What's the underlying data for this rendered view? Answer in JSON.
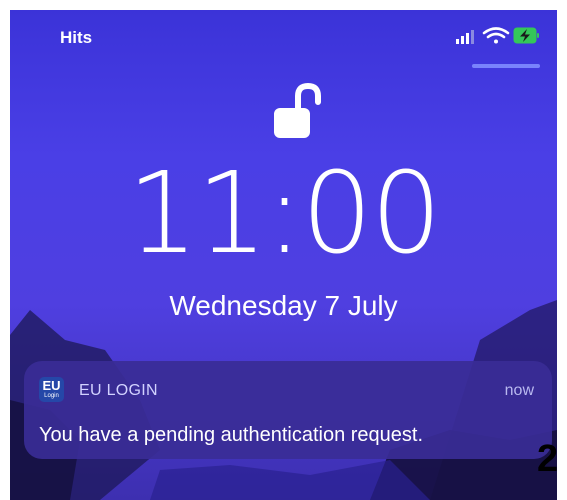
{
  "status_bar": {
    "carrier": "Hits",
    "icons": [
      "signal-icon",
      "wifi-icon",
      "battery-charging-icon"
    ]
  },
  "lock_screen": {
    "lock_icon": "unlocked-padlock-icon",
    "time": "11:00",
    "date": "Wednesday 7 July"
  },
  "notification": {
    "app_icon_text": "EU",
    "app_icon_subtext": "Login",
    "app_name": "EU LOGIN",
    "time": "now",
    "message": "You have a pending authentication request."
  },
  "annotation": {
    "number": "2"
  },
  "colors": {
    "background": "#4a3fe6",
    "notification_bg": "#3a2d96",
    "app_icon_bg": "#2547a8",
    "battery_green": "#34c759"
  }
}
